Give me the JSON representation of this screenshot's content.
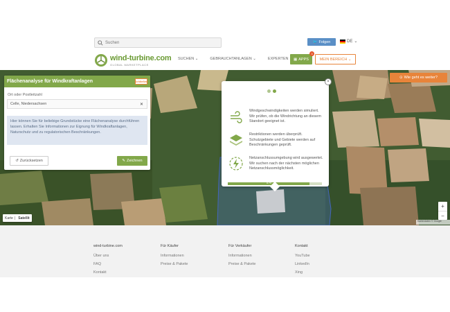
{
  "header": {
    "search_placeholder": "Suchen",
    "twitter_label": "Folgen",
    "lang": "DE",
    "logo_name": "wind-turbine.com",
    "logo_sub": "GLOBAL MARKETPLACE",
    "menu": [
      "SUCHEN ⌄",
      "GEBRAUCHTANLAGEN ⌄",
      "EXPERTEN ⌄"
    ],
    "apps_label": "APPS",
    "apps_badge": "3",
    "login_label": "MEIN BEREICH ⌄"
  },
  "panel": {
    "title": "Flächenanalyse für Windkraftanlagen",
    "close_label": "Schließen",
    "input_label": "Ort oder Postleitzahl",
    "input_value": "Celle, Niedersachsen",
    "info": "Hier können Sie für beliebige Grundstücke eine Flächenanalyse durchführen lassen. Erhalten Sie Informationen zur Eignung für Windkraftanlagen, Naturschutz und zu regulatorischen Beschränkungen.",
    "back_label": "Zurücksetzen",
    "draw_label": "Zeichnen"
  },
  "modal": {
    "rows": [
      "Windgeschwindigkeiten werden simuliert. Wir prüfen, ob die Windrichtung an diesem Standort geeignet ist.",
      "Restriktionen werden überprüft. Schutzgebiete und Gebiete werden auf Beschränkungen geprüft.",
      "Netzanschlussumgebung wird ausgewertet. Wir suchen nach der nächsten möglichen Netzanschlussmöglichkeit."
    ],
    "progress_label": "87%",
    "progress_value": 0.87
  },
  "map": {
    "whatnext_label": "Wie geht es weiter?",
    "zoom_in": "+",
    "zoom_out": "−",
    "maptype_map": "Karte",
    "maptype_sat": "Satellit",
    "attribution": "Kartendaten © Google"
  },
  "footer": {
    "columns": [
      {
        "title": "wind-turbine.com",
        "links": [
          "Über uns",
          "FAQ",
          "Kontakt"
        ]
      },
      {
        "title": "Für Käufer",
        "links": [
          "Informationen",
          "Preise & Pakete"
        ]
      },
      {
        "title": "Für Verkäufer",
        "links": [
          "Informationen",
          "Preise & Pakete"
        ]
      },
      {
        "title": "Kontakt",
        "links": [
          "YouTube",
          "LinkedIn",
          "Xing"
        ]
      }
    ]
  },
  "colors": {
    "accent": "#82a84a",
    "orange": "#e8843a",
    "info_bg": "#dfe6f1"
  }
}
